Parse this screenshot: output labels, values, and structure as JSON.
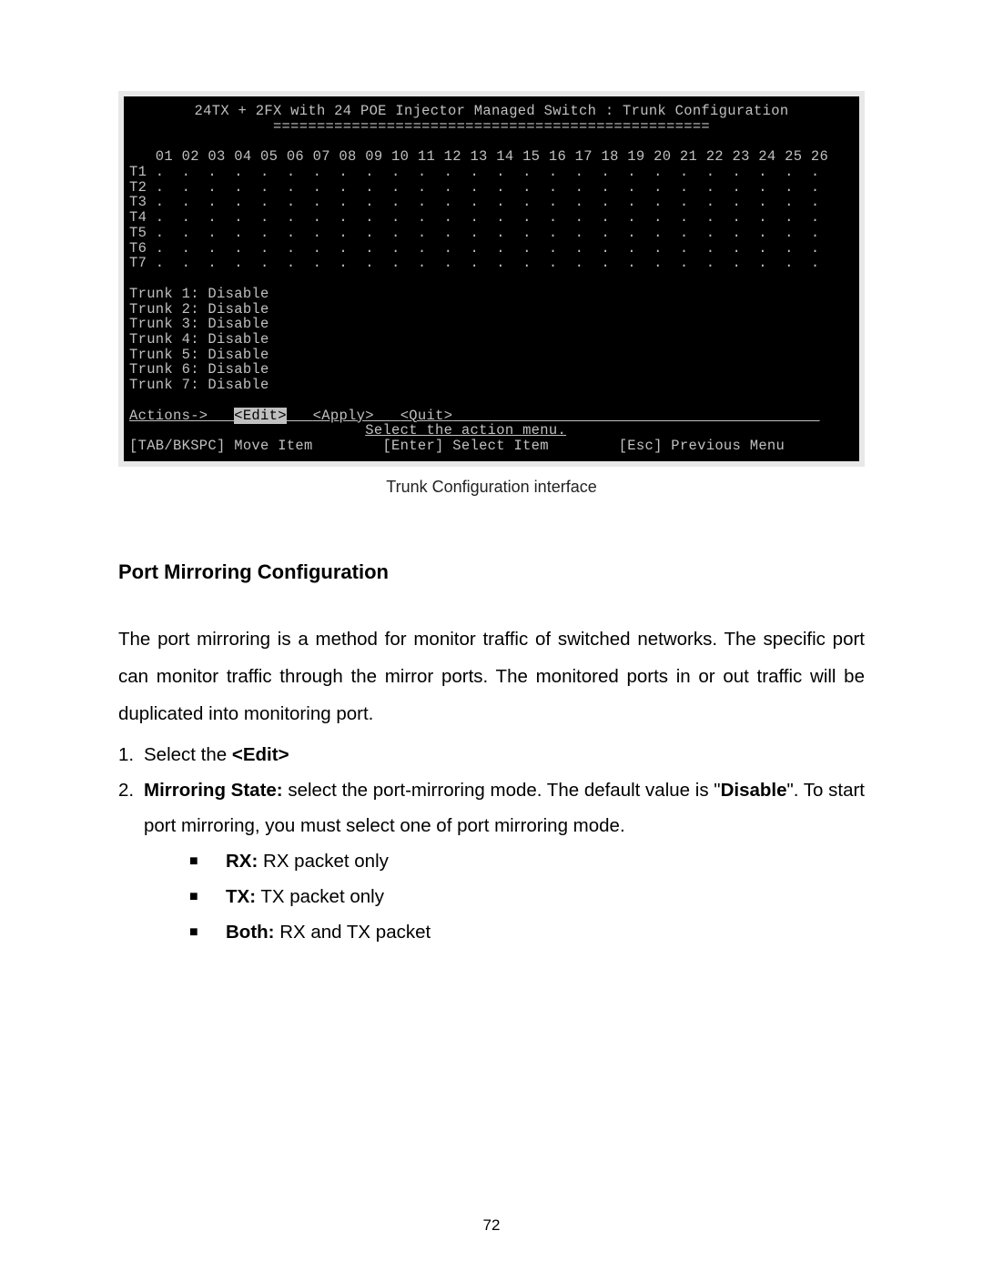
{
  "terminal": {
    "title": "24TX + 2FX with 24 POE Injector Managed Switch : Trunk Configuration",
    "divider": "==================================================",
    "col_header": "   01 02 03 04 05 06 07 08 09 10 11 12 13 14 15 16 17 18 19 20 21 22 23 24 25 26",
    "rows": [
      "T1 .  .  .  .  .  .  .  .  .  .  .  .  .  .  .  .  .  .  .  .  .  .  .  .  .  .",
      "T2 .  .  .  .  .  .  .  .  .  .  .  .  .  .  .  .  .  .  .  .  .  .  .  .  .  .",
      "T3 .  .  .  .  .  .  .  .  .  .  .  .  .  .  .  .  .  .  .  .  .  .  .  .  .  .",
      "T4 .  .  .  .  .  .  .  .  .  .  .  .  .  .  .  .  .  .  .  .  .  .  .  .  .  .",
      "T5 .  .  .  .  .  .  .  .  .  .  .  .  .  .  .  .  .  .  .  .  .  .  .  .  .  .",
      "T6 .  .  .  .  .  .  .  .  .  .  .  .  .  .  .  .  .  .  .  .  .  .  .  .  .  .",
      "T7 .  .  .  .  .  .  .  .  .  .  .  .  .  .  .  .  .  .  .  .  .  .  .  .  .  ."
    ],
    "trunk_states": [
      "Trunk 1: Disable",
      "Trunk 2: Disable",
      "Trunk 3: Disable",
      "Trunk 4: Disable",
      "Trunk 5: Disable",
      "Trunk 6: Disable",
      "Trunk 7: Disable"
    ],
    "actions_label": "Actions->",
    "action_edit": "<Edit>",
    "action_apply": "<Apply>",
    "action_quit": "<Quit>",
    "hint": "Select the action menu.",
    "footer_tab": "[TAB/BKSPC] Move Item",
    "footer_enter": "[Enter] Select Item",
    "footer_esc": "[Esc] Previous Menu"
  },
  "caption": "Trunk Configuration interface",
  "heading": "Port Mirroring Configuration",
  "paragraph": "The port mirroring is a method for monitor traffic of switched networks. The specific port can monitor traffic through the mirror ports. The monitored ports in or out traffic will be duplicated into monitoring port.",
  "list": {
    "item1_num": "1.",
    "item1_text_pre": "Select the ",
    "item1_bold": "<Edit>",
    "item2_num": "2.",
    "item2_bold": "Mirroring State:",
    "item2_text_mid": " select the port-mirroring mode. The default value is \"",
    "item2_bold2": "Disable",
    "item2_text_end": "\". To start port mirroring, you must select one of port mirroring mode.",
    "sub": [
      {
        "label": "RX:",
        "text": " RX packet only"
      },
      {
        "label": "TX:",
        "text": " TX packet only"
      },
      {
        "label": "Both:",
        "text": " RX and TX packet"
      }
    ]
  },
  "page_number": "72"
}
